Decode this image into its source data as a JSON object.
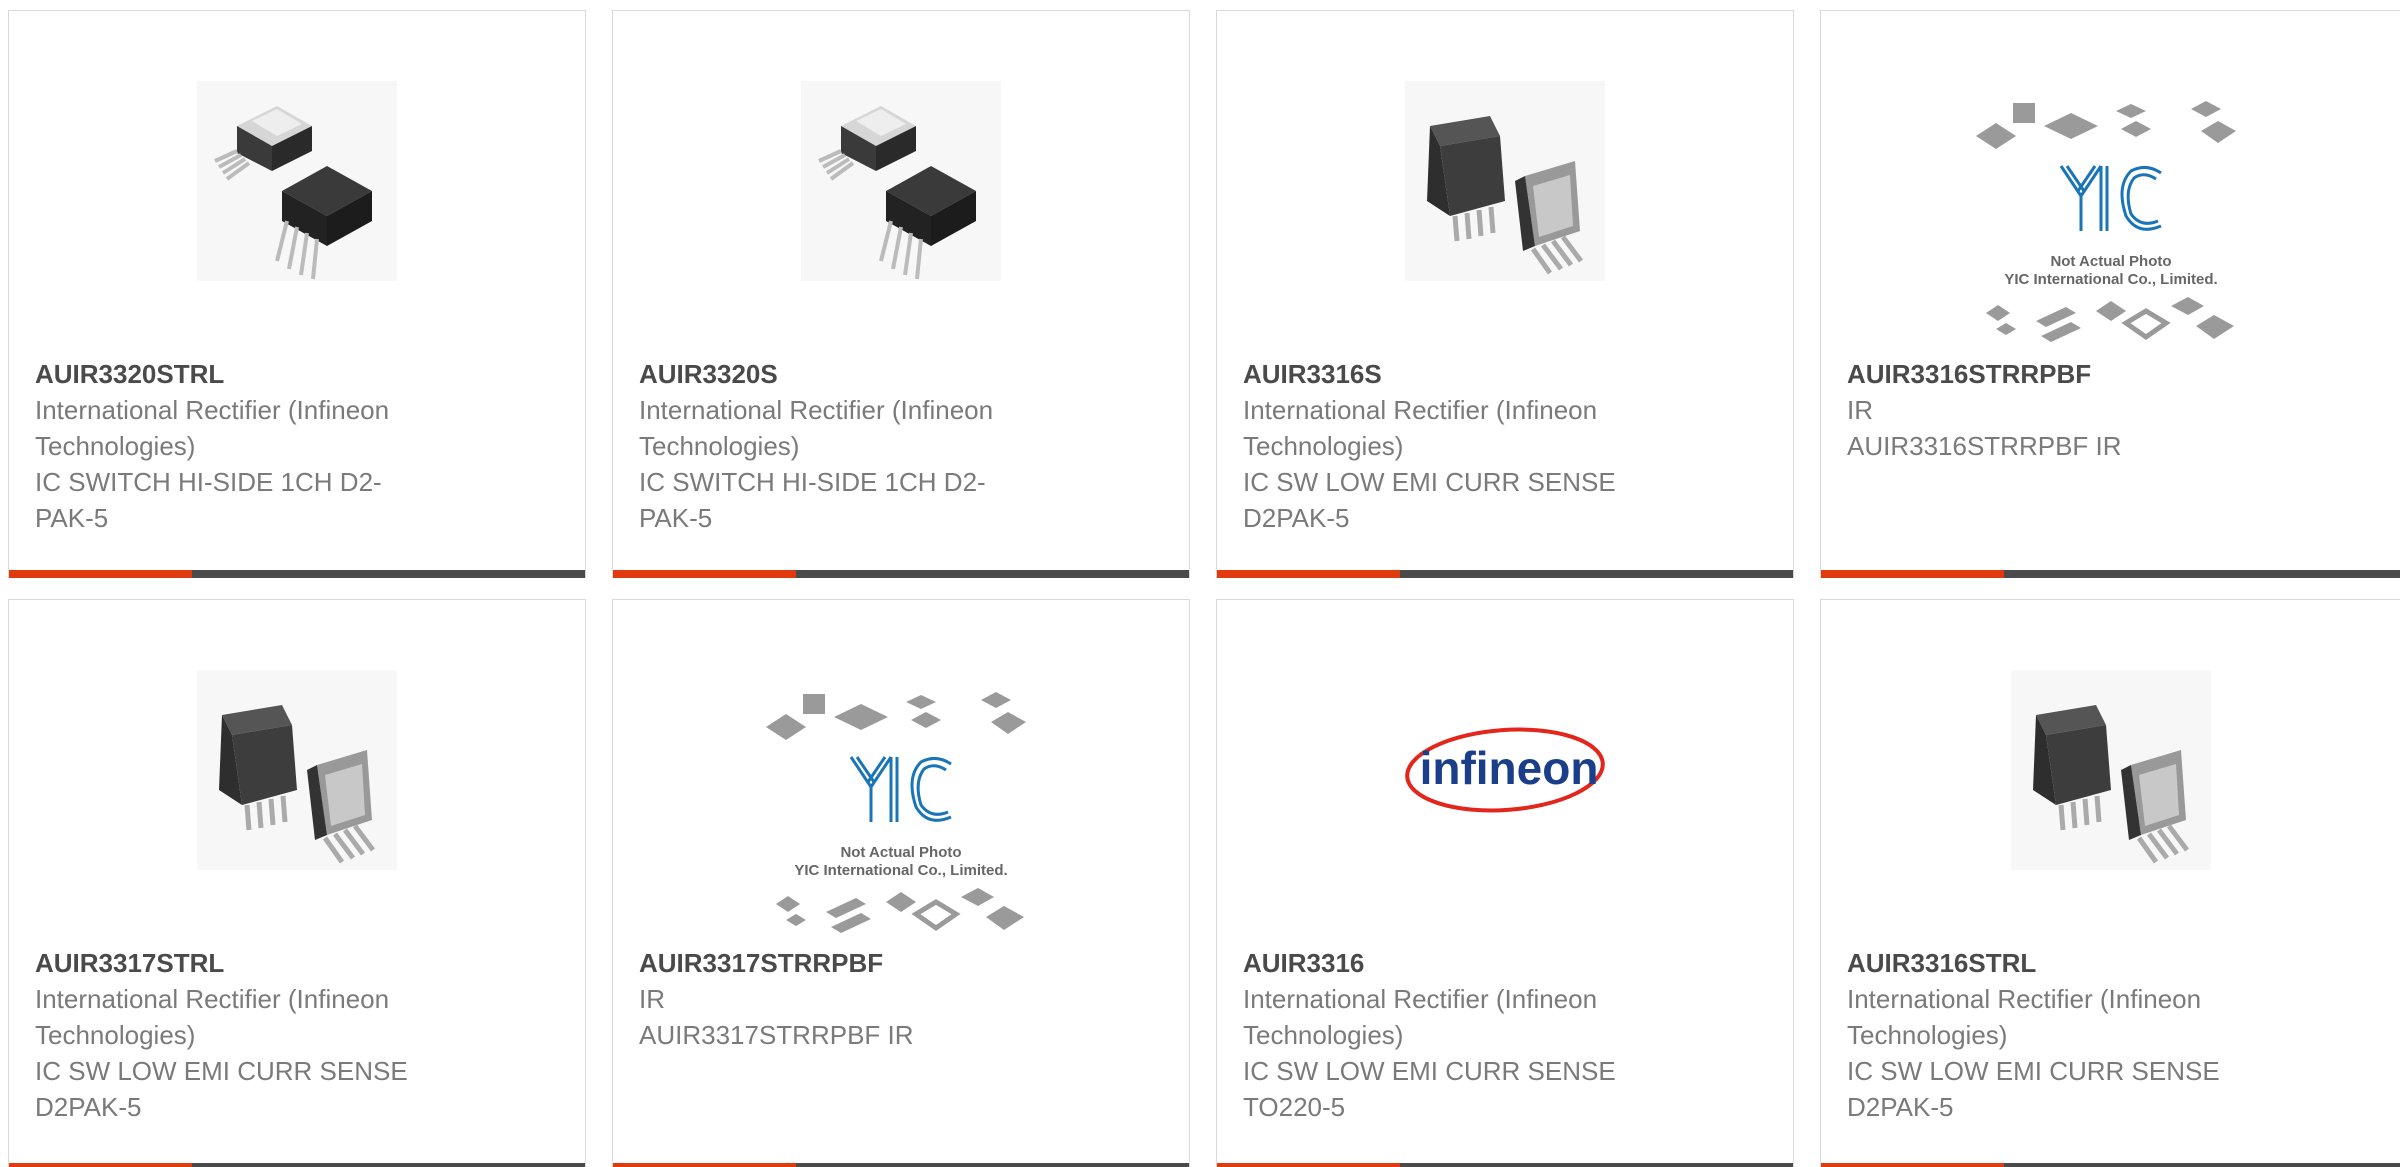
{
  "colors": {
    "accent": "#e03a0e",
    "bar": "#4a4a4a",
    "title": "#4a4a4a",
    "text": "#7a7a7a",
    "yic_logo": "#1a74b8",
    "infineon_red": "#e2261c",
    "infineon_blue": "#1a3e8a"
  },
  "placeholder": {
    "line1": "Not Actual Photo",
    "line2": "YIC International Co., Limited.",
    "logo_text": "YIC"
  },
  "infineon_logo_text": "infineon",
  "products": [
    {
      "part": "AUIR3320STRL",
      "maker_lines": [
        "International Rectifier (Infineon",
        "Technologies)"
      ],
      "desc_lines": [
        "IC SWITCH HI-SIDE 1CH D2-",
        "PAK-5"
      ],
      "image": "d2pak-pair-icon"
    },
    {
      "part": "AUIR3320S",
      "maker_lines": [
        "International Rectifier (Infineon",
        "Technologies)"
      ],
      "desc_lines": [
        "IC SWITCH HI-SIDE 1CH D2-",
        "PAK-5"
      ],
      "image": "d2pak-pair-icon"
    },
    {
      "part": "AUIR3316S",
      "maker_lines": [
        "International Rectifier (Infineon",
        "Technologies)"
      ],
      "desc_lines": [
        "IC SW LOW EMI CURR SENSE",
        "D2PAK-5"
      ],
      "image": "d2pak-front-back-icon"
    },
    {
      "part": "AUIR3316STRRPBF",
      "maker_lines": [
        "IR"
      ],
      "desc_lines": [
        "AUIR3316STRRPBF IR"
      ],
      "image": "not-actual-photo-icon"
    },
    {
      "part": "AUIR3317STRL",
      "maker_lines": [
        "International Rectifier (Infineon",
        "Technologies)"
      ],
      "desc_lines": [
        "IC SW LOW EMI CURR SENSE",
        "D2PAK-5"
      ],
      "image": "d2pak-front-back-icon"
    },
    {
      "part": "AUIR3317STRRPBF",
      "maker_lines": [
        "IR"
      ],
      "desc_lines": [
        "AUIR3317STRRPBF IR"
      ],
      "image": "not-actual-photo-icon"
    },
    {
      "part": "AUIR3316",
      "maker_lines": [
        "International Rectifier (Infineon",
        "Technologies)"
      ],
      "desc_lines": [
        "IC SW LOW EMI CURR SENSE",
        "TO220-5"
      ],
      "image": "infineon-logo-icon"
    },
    {
      "part": "AUIR3316STRL",
      "maker_lines": [
        "International Rectifier (Infineon",
        "Technologies)"
      ],
      "desc_lines": [
        "IC SW LOW EMI CURR SENSE",
        "D2PAK-5"
      ],
      "image": "d2pak-front-back-icon"
    }
  ]
}
